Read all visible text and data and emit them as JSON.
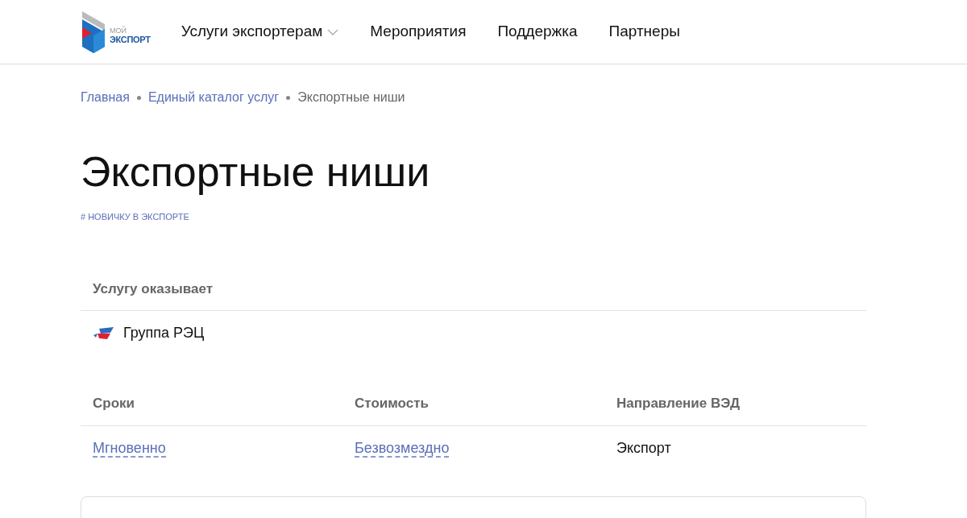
{
  "logo": {
    "line_1": "МОЙ",
    "line_2": "ЭКСПОРТ"
  },
  "nav": [
    {
      "label": "Услуги экспортерам",
      "has_dropdown": true
    },
    {
      "label": "Мероприятия",
      "has_dropdown": false
    },
    {
      "label": "Поддержка",
      "has_dropdown": false
    },
    {
      "label": "Партнеры",
      "has_dropdown": false
    }
  ],
  "breadcrumbs": [
    {
      "label": "Главная",
      "kind": "link"
    },
    {
      "label": "Единый каталог услуг",
      "kind": "link"
    },
    {
      "label": "Экспортные ниши",
      "kind": "current"
    }
  ],
  "title": "Экспортные ниши",
  "tag": "# НОВИЧКУ В ЭКСПОРТЕ",
  "provider": {
    "heading": "Услугу оказывает",
    "name": "Группа РЭЦ"
  },
  "details": [
    {
      "heading": "Сроки",
      "value": "Мгновенно",
      "kind": "link"
    },
    {
      "heading": "Стоимость",
      "value": "Безвозмездно",
      "kind": "link"
    },
    {
      "heading": "Направление ВЭД",
      "value": "Экспорт",
      "kind": "plain"
    }
  ]
}
